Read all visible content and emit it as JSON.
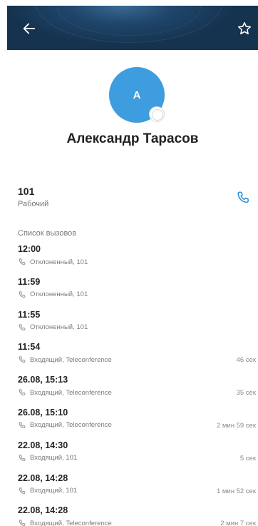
{
  "contact": {
    "initial": "A",
    "name": "Александр Тарасов"
  },
  "phone": {
    "number": "101",
    "type": "Рабочий"
  },
  "history": {
    "title": "Список вызовов",
    "calls": [
      {
        "time": "12:00",
        "desc": "Отклоненный, 101",
        "duration": ""
      },
      {
        "time": "11:59",
        "desc": "Отклоненный, 101",
        "duration": ""
      },
      {
        "time": "11:55",
        "desc": "Отклоненный, 101",
        "duration": ""
      },
      {
        "time": "11:54",
        "desc": "Входящий, Teleconference",
        "duration": "46 сек"
      },
      {
        "time": "26.08, 15:13",
        "desc": "Входящий, Teleconference",
        "duration": "35 сек"
      },
      {
        "time": "26.08, 15:10",
        "desc": "Входящий, Teleconference",
        "duration": "2 мин 59 сек"
      },
      {
        "time": "22.08, 14:30",
        "desc": "Входящий, 101",
        "duration": "5 сек"
      },
      {
        "time": "22.08, 14:28",
        "desc": "Входящий, 101",
        "duration": "1 мин 52 сек"
      },
      {
        "time": "22.08, 14:28",
        "desc": "Входящий, Teleconference",
        "duration": "2 мин 7 сек"
      }
    ]
  },
  "icons": {
    "back": "arrow-left-icon",
    "favorite": "star-outline-icon",
    "call": "phone-icon",
    "call_entry": "phone-small-icon"
  },
  "colors": {
    "header": "#1f4468",
    "avatar": "#3d9ddf",
    "accent": "#2a8ad6"
  }
}
